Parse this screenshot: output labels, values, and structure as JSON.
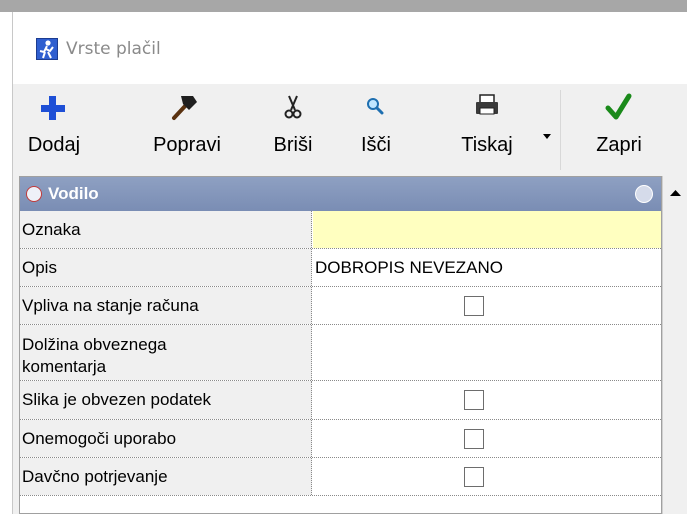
{
  "window": {
    "title": "Vrste plačil"
  },
  "toolbar": {
    "buttons": [
      {
        "label": "Dodaj",
        "icon": "plus-icon"
      },
      {
        "label": "Popravi",
        "icon": "hammer-icon"
      },
      {
        "label": "Briši",
        "icon": "scissors-icon"
      },
      {
        "label": "Išči",
        "icon": "search-icon"
      },
      {
        "label": "Tiskaj",
        "icon": "printer-icon"
      },
      {
        "label": "Zapri",
        "icon": "checkmark-icon"
      }
    ]
  },
  "grid": {
    "category": "Vodilo",
    "rows": [
      {
        "label": "Oznaka",
        "value": "",
        "type": "text"
      },
      {
        "label": "Opis",
        "value": "DOBROPIS NEVEZANO",
        "type": "text"
      },
      {
        "label": "Vpliva na stanje računa",
        "type": "checkbox",
        "checked": false
      },
      {
        "label_line1": "Dolžina obveznega",
        "label_line2": "komentarja",
        "value": "",
        "type": "text"
      },
      {
        "label": "Slika je obvezen podatek",
        "type": "checkbox",
        "checked": false
      },
      {
        "label": "Onemogoči uporabo",
        "type": "checkbox",
        "checked": false
      },
      {
        "label": "Davčno potrjevanje",
        "type": "checkbox",
        "checked": false
      }
    ]
  },
  "colors": {
    "category_header": "#7f91b7",
    "focused_value_bg": "#ffffc0",
    "plus_blue": "#1e4fd6",
    "check_green": "#1a8a1a"
  }
}
